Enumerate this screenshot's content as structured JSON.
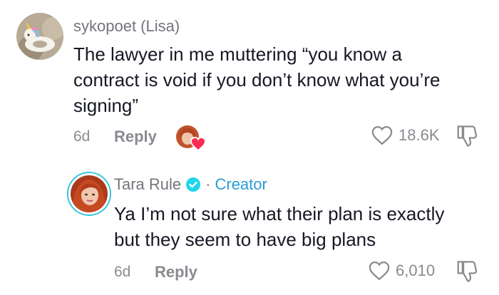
{
  "comments": [
    {
      "username": "sykopoet (Lisa)",
      "text_lines": [
        "The lawyer in me muttering “you know a",
        "contract is void if you don’t know what you’re",
        "signing”"
      ],
      "time": "6d",
      "reply_label": "Reply",
      "likes": "18.6K",
      "creator_liked": true
    },
    {
      "username": "Tara Rule",
      "verified": true,
      "separator": "·",
      "badge": "Creator",
      "text_lines": [
        "Ya I’m not sure what their plan is exactly",
        "but they seem to have big plans"
      ],
      "time": "6d",
      "reply_label": "Reply",
      "likes": "6,010"
    }
  ],
  "icons": {
    "like": "heart-outline-icon",
    "dislike": "thumbs-down-icon",
    "verified": "verified-check-icon",
    "creator_liked": "creator-liked-heart-icon"
  },
  "colors": {
    "text": "#161823",
    "muted": "#8a8b91",
    "creator": "#2a9bd8",
    "liked_heart": "#fe2c55"
  }
}
